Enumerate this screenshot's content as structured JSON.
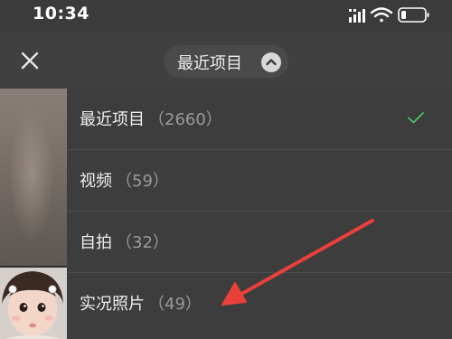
{
  "status_bar": {
    "time": "10:34",
    "icons": [
      "signal-icon",
      "wifi-icon",
      "battery-icon"
    ]
  },
  "header": {
    "close_icon": "close-icon",
    "album_selector_label": "最近项目",
    "album_selector_icon": "chevron-up-icon"
  },
  "album_menu": {
    "items": [
      {
        "name": "最近项目",
        "count": "（2660）",
        "selected": true
      },
      {
        "name": "视频",
        "count": "（59）",
        "selected": false
      },
      {
        "name": "自拍",
        "count": "（32）",
        "selected": false
      },
      {
        "name": "实况照片",
        "count": "（49）",
        "selected": false
      }
    ]
  },
  "colors": {
    "accent_check": "#4cc26a",
    "annotation_arrow": "#e8403a",
    "menu_bg": "#3d3d3d",
    "header_bg": "#404040"
  }
}
